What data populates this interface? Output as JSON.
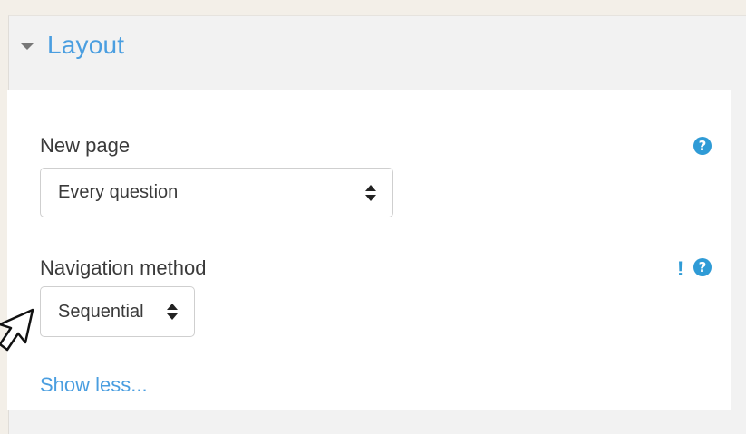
{
  "section": {
    "title": "Layout",
    "caret_icon": "caret-down-icon"
  },
  "fields": {
    "new_page": {
      "label": "New page",
      "selected": "Every question",
      "help_icon": "question-circle-icon",
      "help_glyph": "?"
    },
    "navigation_method": {
      "label": "Navigation method",
      "selected": "Sequential",
      "advanced_icon": "exclamation-icon",
      "advanced_glyph": "!",
      "help_icon": "question-circle-icon",
      "help_glyph": "?"
    }
  },
  "show_less": {
    "label": "Show less..."
  },
  "colors": {
    "accent_blue": "#4a9ee0",
    "help_blue": "#2f9bd6",
    "panel_bg": "#f2f2f2",
    "page_bg": "#f3efe8"
  }
}
